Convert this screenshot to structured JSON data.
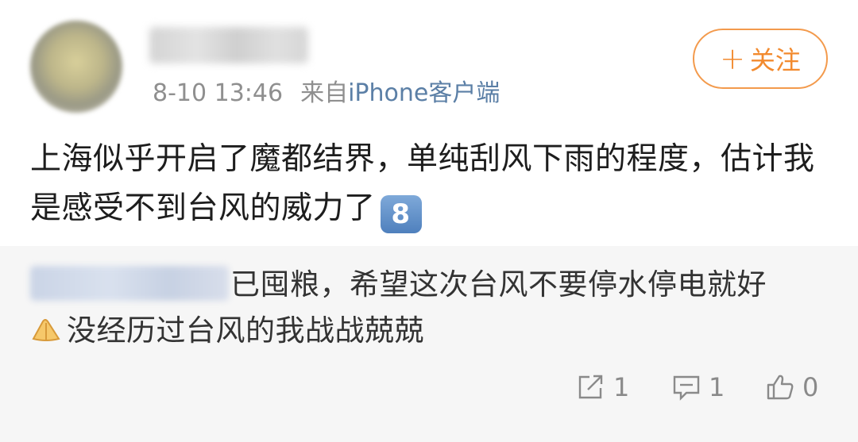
{
  "post": {
    "timestamp": "8-10 13:46",
    "source_prefix": "来自",
    "source_device": "iPhone客户端",
    "follow_label": "关注",
    "follow_plus": "+",
    "text": "上海似乎开启了魔都结界，单纯刮风下雨的程度，估计我是感受不到台风的威力了",
    "badge": "8"
  },
  "repost": {
    "text_line1": "已囤粮，希望这次台风不要停水停电就好",
    "text_line2": "没经历过台风的我战战兢兢"
  },
  "actions": {
    "repost_count": "1",
    "comment_count": "1",
    "like_count": "0"
  },
  "colors": {
    "accent": "#f28a2e",
    "link": "#5b7fa6",
    "muted": "#8f8f8f"
  },
  "icons": {
    "repost": "share-square-arrow-icon",
    "comment": "comment-bubble-icon",
    "like": "thumbs-up-icon",
    "hand": "pressed-hands-emoji-icon"
  }
}
